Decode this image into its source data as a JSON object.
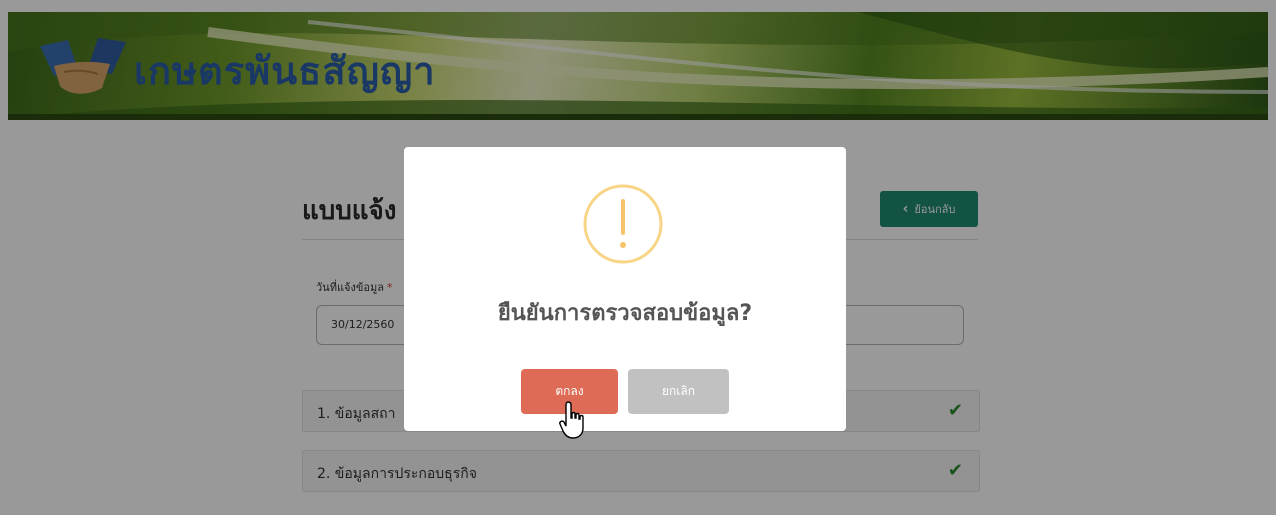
{
  "header": {
    "brand_name": "เกษตรพันธสัญญา",
    "colors": {
      "green_dark": "#2d4a12",
      "green_light": "#c9d96f",
      "brand_blue": "#2a5ea8"
    }
  },
  "page": {
    "form_title": "แบบแจ้ง",
    "back_button_label": "ย้อนกลับ",
    "back_icon": "chevron-left-icon",
    "date_label": "วันที่แจ้งข้อมูล",
    "date_value": "30/12/2560",
    "sections": [
      {
        "label": "1. ข้อมูลสถา",
        "status_icon": "check-icon"
      },
      {
        "label": "2. ข้อมูลการประกอบธุรกิจ",
        "status_icon": "check-icon"
      }
    ]
  },
  "dialog": {
    "icon": "warning-icon",
    "title": "ยืนยันการตรวจสอบข้อมูล?",
    "confirm_label": "ตกลง",
    "cancel_label": "ยกเลิก",
    "colors": {
      "confirm": "#dd6b55",
      "cancel": "#c1c1c1",
      "warning": "#f8d486"
    }
  }
}
